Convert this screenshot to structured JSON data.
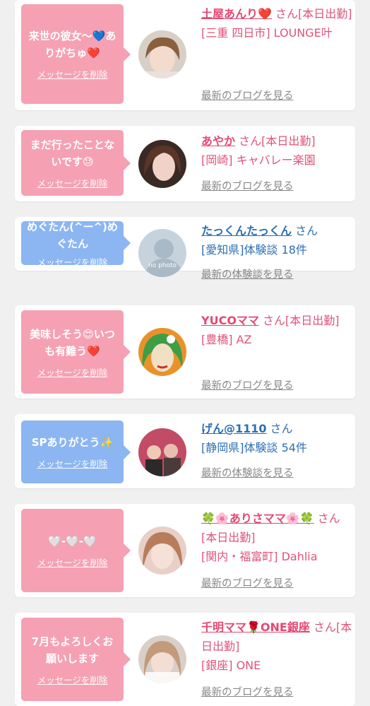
{
  "delete_label": "メッセージを削除",
  "items": [
    {
      "message": "来世の彼女〜💙ありがちゅ❤️",
      "name": "土屋あんり❤️",
      "suffix": "さん[本日出勤]",
      "area": "[三重 四日市] LOUNGE叶",
      "link": "最新のブログを見る",
      "type": "cast"
    },
    {
      "message": "まだ行ったことないです😓",
      "name": "あやか",
      "suffix": "さん[本日出勤]",
      "area": "[岡崎] キャバレー楽園",
      "link": "最新のブログを見る",
      "type": "cast"
    },
    {
      "message": "めぐたん(^ー^)めぐたん",
      "name": "たっくんたっくん",
      "suffix": "さん",
      "area": "[愛知県]体験談 18件",
      "link": "最新の体験談を見る",
      "type": "user",
      "avatar_text": "no photo"
    },
    {
      "message": "美味しそう😍いつも有難う❤️",
      "name": "YUCOママ",
      "suffix": "さん[本日出勤]",
      "area": "[豊橋] AZ",
      "link": "最新のブログを見る",
      "type": "cast"
    },
    {
      "message": "SPありがとう✨",
      "name": "げん@1110",
      "suffix": "さん",
      "area": "[静岡県]体験談 54件",
      "link": "最新の体験談を見る",
      "type": "user"
    },
    {
      "message": "🤍-🤍-🤍",
      "name": "🍀🌸ありさママ🌸🍀",
      "suffix": "さん[本日出勤]",
      "area": "[関内・福富町] Dahlia",
      "link": "最新のブログを見る",
      "type": "cast"
    },
    {
      "message": "7月もよろしくお願いします",
      "name": "千明ママ🌹ONE銀座",
      "suffix": "さん[本日出勤]",
      "area": "[銀座] ONE",
      "link": "最新のブログを見る",
      "type": "cast"
    }
  ],
  "colors": {
    "pink_bubble": "#f5a1b3",
    "blue_bubble": "#8cb6f2",
    "pink_name": "#e44872",
    "blue_name": "#2d6fb2"
  }
}
